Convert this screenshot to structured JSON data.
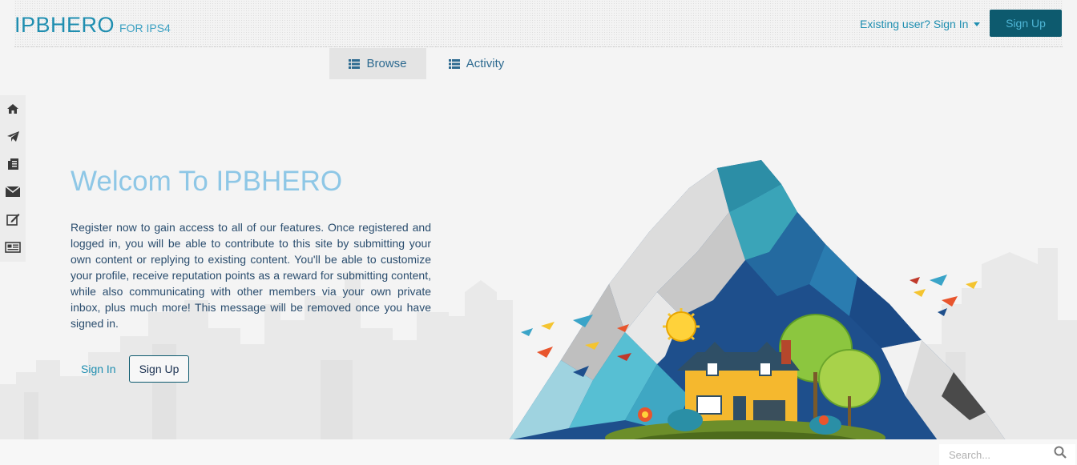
{
  "header": {
    "logo_main": "IPBHERO",
    "logo_sub": "FOR IPS4",
    "signin_label": "Existing user? Sign In",
    "signup_label": "Sign Up"
  },
  "tabs": [
    {
      "label": "Browse",
      "active": true
    },
    {
      "label": "Activity",
      "active": false
    }
  ],
  "sidebar": {
    "items": [
      {
        "icon": "home-icon"
      },
      {
        "icon": "paper-plane-icon"
      },
      {
        "icon": "document-icon"
      },
      {
        "icon": "envelope-icon"
      },
      {
        "icon": "edit-icon"
      },
      {
        "icon": "newspaper-icon"
      }
    ]
  },
  "hero": {
    "title": "Welcom To IPBHERO",
    "description": "Register now to gain access to all of our features. Once registered and logged in, you will be able to contribute to this site by submitting your own content or replying to existing content. You'll be able to customize your profile, receive reputation points as a reward for submitting content, while also communicating with other members via your own private inbox, plus much more! This message will be removed once you have signed in.",
    "signin_label": "Sign In",
    "signup_label": "Sign Up"
  },
  "footer": {
    "search_placeholder": "Search..."
  },
  "colors": {
    "brand": "#1f8eb0",
    "signup_bg": "#0d5a6e",
    "title": "#8ec7e6"
  }
}
